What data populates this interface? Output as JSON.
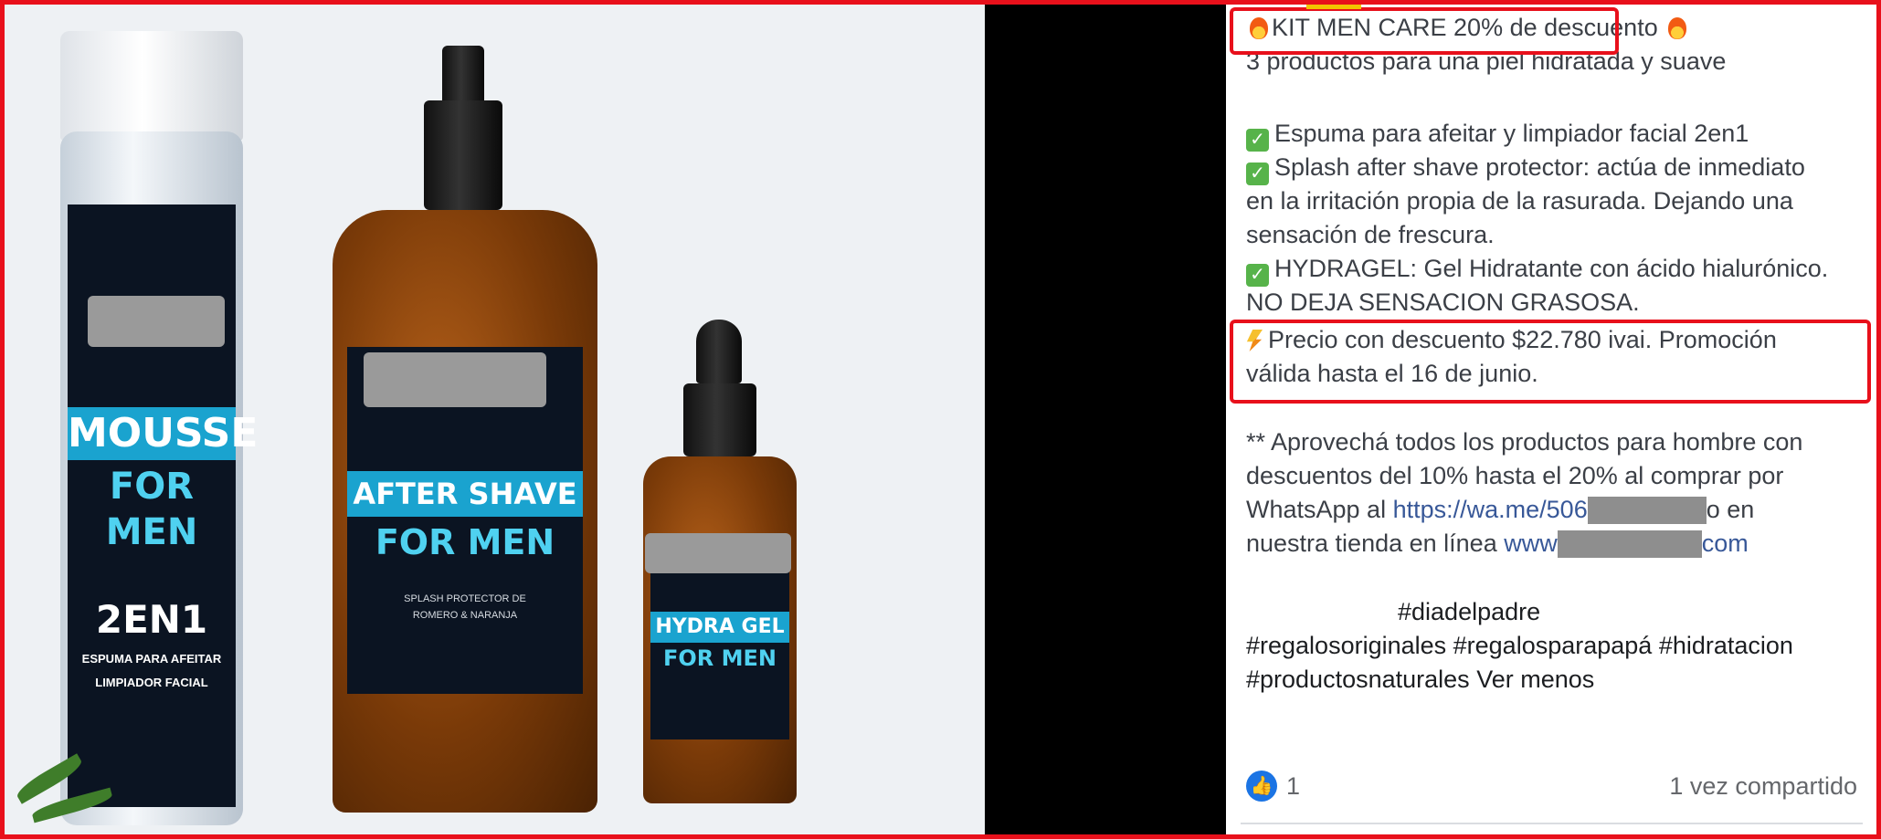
{
  "post": {
    "title_line": "KIT MEN CARE 20% de descuento",
    "subtitle": "3 productos para una piel hidratada y suave",
    "item1": "Espuma para afeitar y limpiador facial 2en1",
    "item2_line1": "Splash after shave protector: actúa de inmediato",
    "item2_line2": "en la irritación propia de la rasurada. Dejando una",
    "item2_line3": "sensación de frescura.",
    "item3_line1": "HYDRAGEL: Gel Hidratante con ácido hialurónico.",
    "item3_line2": "NO DEJA SENSACION GRASOSA.",
    "price_line1": "Precio con descuento $22.780 ivai. Promoción",
    "price_line2": "válida hasta el 16 de junio.",
    "promo_line1": "** Aprovechá todos los productos para hombre con",
    "promo_line2": "descuentos del 10% hasta el 20% al comprar por",
    "promo_line3_prefix": "WhatsApp al",
    "promo_link": "https://wa.me/506",
    "promo_line3_suffix": "o en",
    "promo_line4_prefix": "nuestra tienda en línea",
    "store_link_start": "www",
    "store_link_end": "com",
    "hashtag1": "#diadelpadre",
    "hashtags_line2": "#regalosoriginales #regalosparapapá #hidratacion",
    "hashtags_line3": "#productosnaturales",
    "see_less": "Ver menos",
    "like_count": "1",
    "shares": "1 vez compartido"
  },
  "products": {
    "mousse_line1": "MOUSSE",
    "mousse_line2": "FOR MEN",
    "mousse_2en1": "2EN1",
    "mousse_desc1": "ESPUMA PARA AFEITAR",
    "mousse_desc2": "LIMPIADOR FACIAL",
    "after_line1": "AFTER SHAVE",
    "after_line2": "FOR MEN",
    "after_desc1": "SPLASH PROTECTOR DE",
    "after_desc2": "ROMERO & NARANJA",
    "hydra_line1": "HYDRA GEL",
    "hydra_line2": "FOR MEN"
  },
  "icons": [
    "fire-icon",
    "check-icon",
    "lightning-icon",
    "like-icon"
  ],
  "colors": {
    "highlight": "#e8101b",
    "link": "#385898",
    "like": "#1b74e4",
    "check": "#57b34a"
  }
}
